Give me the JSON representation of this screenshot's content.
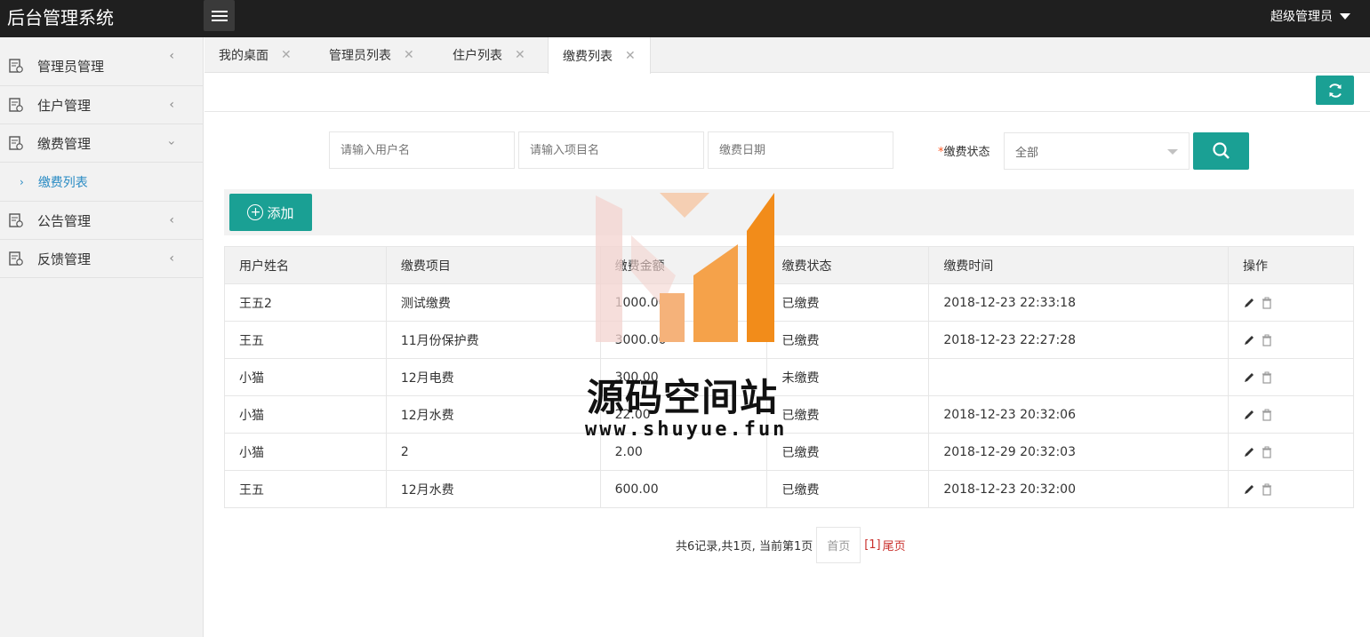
{
  "header": {
    "app_title": "后台管理系统",
    "user_label": "超级管理员"
  },
  "sidebar": {
    "items": [
      {
        "label": "管理员管理",
        "expanded": false
      },
      {
        "label": "住户管理",
        "expanded": false
      },
      {
        "label": "缴费管理",
        "expanded": true,
        "children": [
          {
            "label": "缴费列表",
            "active": true
          }
        ]
      },
      {
        "label": "公告管理",
        "expanded": false
      },
      {
        "label": "反馈管理",
        "expanded": false
      }
    ]
  },
  "tabs": [
    {
      "label": "我的桌面",
      "active": false
    },
    {
      "label": "管理员列表",
      "active": false
    },
    {
      "label": "住户列表",
      "active": false
    },
    {
      "label": "缴费列表",
      "active": true
    }
  ],
  "search": {
    "username_placeholder": "请输入用户名",
    "project_placeholder": "请输入项目名",
    "date_placeholder": "缴费日期",
    "status_label": "缴费状态",
    "status_required_mark": "*",
    "status_value": "全部"
  },
  "actions": {
    "add_label": "添加"
  },
  "table": {
    "headers": [
      "用户姓名",
      "缴费项目",
      "缴费金额",
      "缴费状态",
      "缴费时间",
      "操作"
    ],
    "rows": [
      [
        "王五2",
        "测试缴费",
        "1000.00",
        "已缴费",
        "2018-12-23 22:33:18"
      ],
      [
        "王五",
        "11月份保护费",
        "3000.00",
        "已缴费",
        "2018-12-23 22:27:28"
      ],
      [
        "小猫",
        "12月电费",
        "300.00",
        "未缴费",
        ""
      ],
      [
        "小猫",
        "12月水费",
        "22.00",
        "已缴费",
        "2018-12-23 20:32:06"
      ],
      [
        "小猫",
        "2",
        "2.00",
        "已缴费",
        "2018-12-29 20:32:03"
      ],
      [
        "王五",
        "12月水费",
        "600.00",
        "已缴费",
        "2018-12-23 20:32:00"
      ]
    ]
  },
  "pager": {
    "summary": "共6记录,共1页, 当前第1页",
    "first_label": "首页",
    "current_label": "[1]",
    "last_label": "尾页"
  },
  "watermark": {
    "title": "源码空间站",
    "url": "www.shuyue.fun"
  },
  "colors": {
    "accent": "#1aa094",
    "header_bg": "#1f1f1f",
    "sidebar_bg": "#f2f2f2",
    "active_link": "#2b8cc4",
    "pager_link": "#c9302c"
  }
}
